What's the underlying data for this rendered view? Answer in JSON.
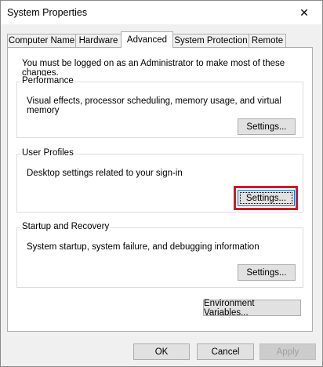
{
  "window": {
    "title": "System Properties",
    "close_glyph": "✕"
  },
  "tabs": [
    {
      "label": "Computer Name"
    },
    {
      "label": "Hardware"
    },
    {
      "label": "Advanced",
      "active": true
    },
    {
      "label": "System Protection"
    },
    {
      "label": "Remote"
    }
  ],
  "advanced": {
    "admin_note": "You must be logged on as an Administrator to make most of these changes.",
    "performance": {
      "title": "Performance",
      "description": "Visual effects, processor scheduling, memory usage, and virtual memory",
      "settings_label": "Settings..."
    },
    "user_profiles": {
      "title": "User Profiles",
      "description": "Desktop settings related to your sign-in",
      "settings_label": "Settings..."
    },
    "startup_recovery": {
      "title": "Startup and Recovery",
      "description": "System startup, system failure, and debugging information",
      "settings_label": "Settings..."
    },
    "env_vars_label": "Environment Variables..."
  },
  "footer": {
    "ok_label": "OK",
    "cancel_label": "Cancel",
    "apply_label": "Apply"
  },
  "colors": {
    "highlight": "#d0192a",
    "focus_border": "#0078d7"
  }
}
